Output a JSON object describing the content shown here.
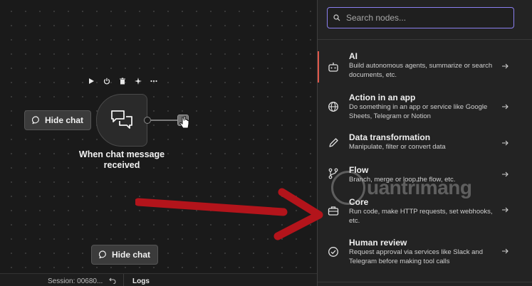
{
  "canvas": {
    "trigger_node": {
      "title_line1": "When chat message",
      "title_line2": "received",
      "toolbar": [
        "play-icon",
        "power-icon",
        "trash-icon",
        "sparkle-icon",
        "more-icon"
      ]
    },
    "hide_chat_label": "Hide chat"
  },
  "bottom_bar": {
    "session": "Session: 00680...",
    "logs": "Logs"
  },
  "panel": {
    "search": {
      "placeholder": "Search nodes...",
      "value": ""
    },
    "categories": [
      {
        "title": "AI",
        "desc": "Build autonomous agents, summarize or search documents, etc.",
        "icon": "robot-icon"
      },
      {
        "title": "Action in an app",
        "desc": "Do something in an app or service like Google Sheets, Telegram or Notion",
        "icon": "globe-icon"
      },
      {
        "title": "Data transformation",
        "desc": "Manipulate, filter or convert data",
        "icon": "pen-icon"
      },
      {
        "title": "Flow",
        "desc": "Branch, merge or loop the flow, etc.",
        "icon": "branch-icon"
      },
      {
        "title": "Core",
        "desc": "Run code, make HTTP requests, set webhooks, etc.",
        "icon": "toolbox-icon"
      },
      {
        "title": "Human review",
        "desc": "Request approval via services like Slack and Telegram before making tool calls",
        "icon": "check-circle-icon"
      }
    ]
  },
  "watermark": {
    "text": "uantrimang"
  },
  "colors": {
    "accent": "#8b80f0",
    "active_marker": "#e0584b",
    "arrow": "#b3141b"
  }
}
